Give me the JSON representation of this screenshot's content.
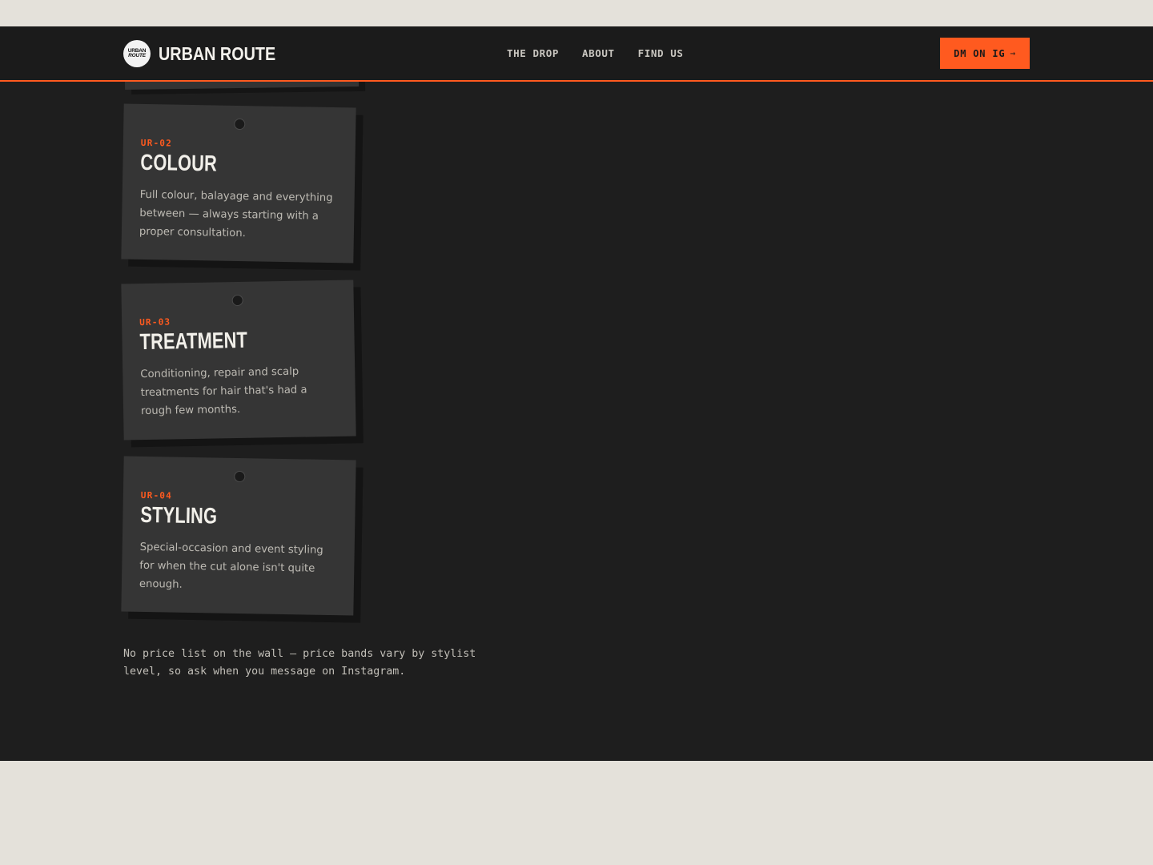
{
  "nav": {
    "brand": {
      "badge_line1": "URBAN",
      "badge_line2": "ROUTE",
      "name": "URBAN ROUTE"
    },
    "links": [
      "THE DROP",
      "ABOUT",
      "FIND US"
    ],
    "cta": {
      "label": "DM ON IG",
      "arrow": "→"
    }
  },
  "services": [
    {
      "code": "UR-02",
      "title": "COLOUR",
      "description": "Full colour, balayage and everything between — always starting with a proper consultation."
    },
    {
      "code": "UR-03",
      "title": "TREATMENT",
      "description": "Conditioning, repair and scalp treatments for hair that's had a rough few months."
    },
    {
      "code": "UR-04",
      "title": "STYLING",
      "description": "Special-occasion and event styling for when the cut alone isn't quite enough."
    }
  ],
  "note": "No price list on the wall — price bands vary by stylist level, so ask when you message on Instagram.",
  "colors": {
    "accent": "#ff5a1f",
    "page_bg": "#e4e1da",
    "panel_bg": "#1e1e1e",
    "card_bg": "#353535"
  }
}
